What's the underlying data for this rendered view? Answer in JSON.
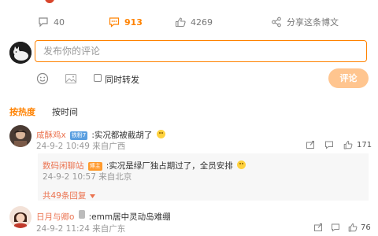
{
  "stats": {
    "comment_count": "40",
    "like_count": "913",
    "repost_count": "4269",
    "share_label": "分享这条博文"
  },
  "composer": {
    "placeholder": "发布你的评论",
    "repost_label": "同时转发",
    "submit_label": "评论"
  },
  "sort": {
    "hot_label": "按热度",
    "time_label": "按时间"
  },
  "comments": [
    {
      "username": "咸酥鸡x",
      "badge": "铁粉7",
      "text": ":实况都被截胡了",
      "time": "24-9-2 10:49 来自广西",
      "likes": "171",
      "replies": [
        {
          "username": "数码闲聊站",
          "badge": "博主",
          "text": ":实况是绿厂独占期过了，全员安排",
          "time": "24-9-2 10:57 来自北京"
        }
      ],
      "more_replies": "共49条回复"
    },
    {
      "username": "日月与卿o",
      "text": ":emm居中灵动岛难绷",
      "time": "24-9-2 11:24 来自广东",
      "likes": "76"
    }
  ],
  "colors": {
    "accent": "#ff8200",
    "username": "#eb7350",
    "submit_disabled": "#ffc58f"
  }
}
